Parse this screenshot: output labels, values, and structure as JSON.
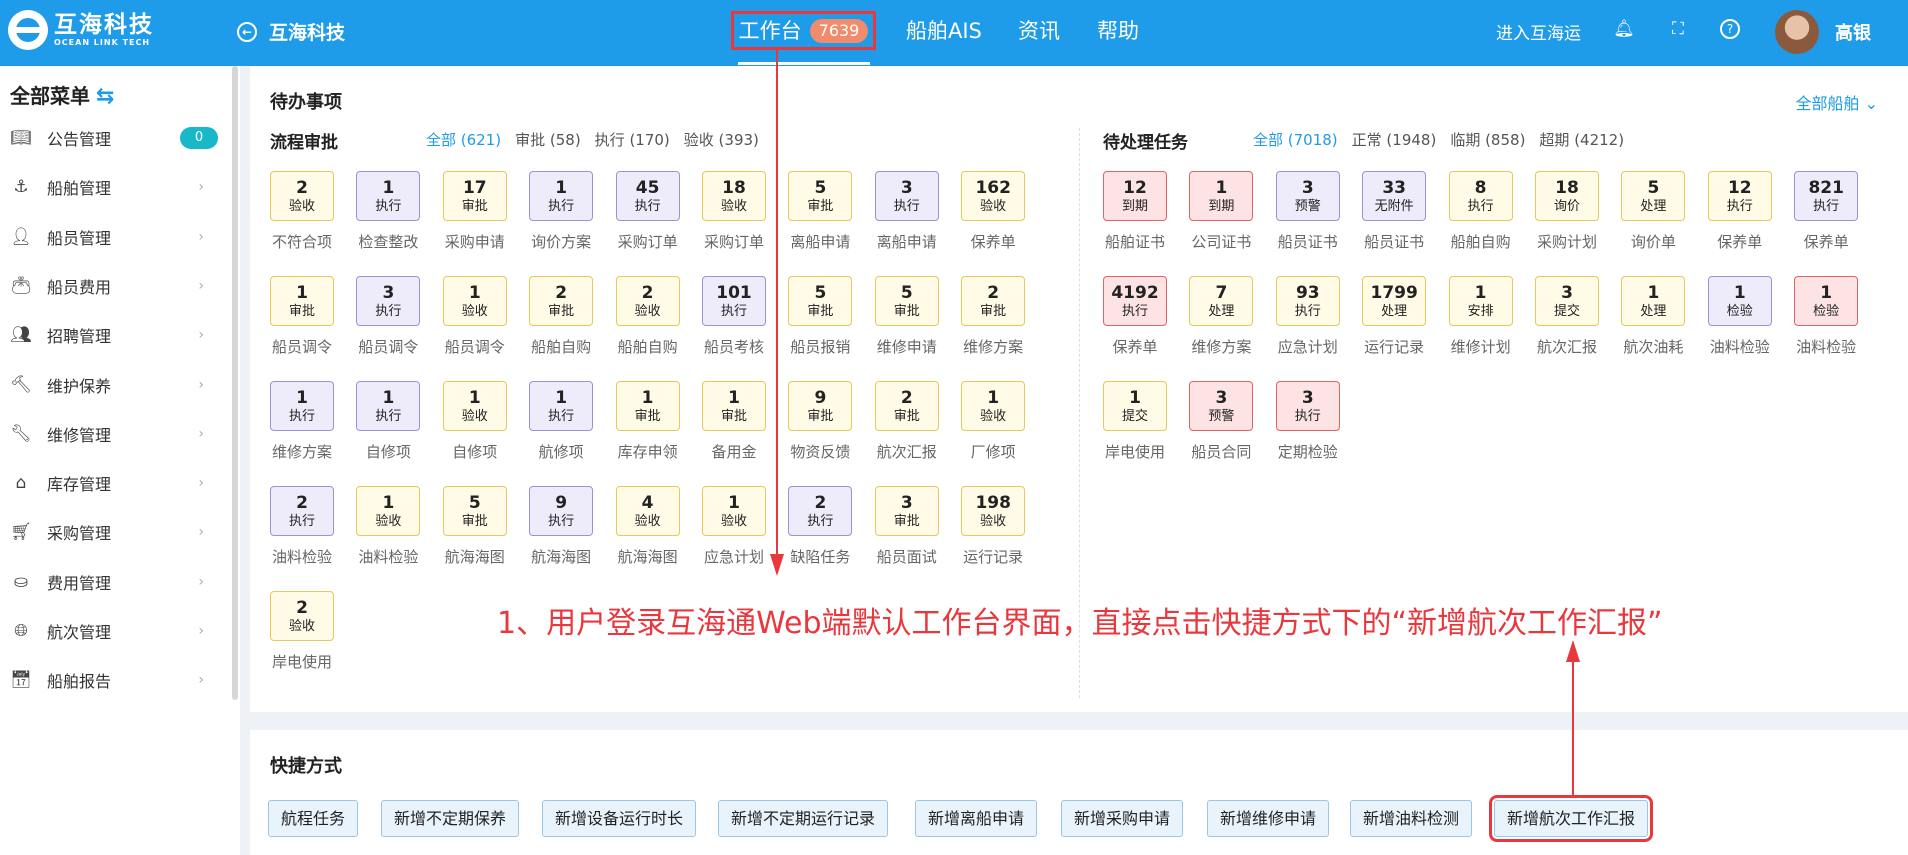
{
  "app": {
    "logo_cn": "互海科技",
    "logo_en": "OCEAN LINK TECH",
    "back_title": "互海科技"
  },
  "nav": {
    "workbench": "工作台",
    "workbench_count": "7639",
    "ais": "船舶AIS",
    "news": "资讯",
    "help": "帮助"
  },
  "header_right": {
    "enter": "进入互海运",
    "user": "高银"
  },
  "sidebar": {
    "title": "全部菜单",
    "items": [
      {
        "label": "公告管理",
        "icon": "document-icon",
        "badge": "0"
      },
      {
        "label": "船舶管理",
        "icon": "anchor-icon"
      },
      {
        "label": "船员管理",
        "icon": "person-icon"
      },
      {
        "label": "船员费用",
        "icon": "wallet-icon"
      },
      {
        "label": "招聘管理",
        "icon": "recruit-icon"
      },
      {
        "label": "维护保养",
        "icon": "hammer-icon"
      },
      {
        "label": "维修管理",
        "icon": "wrench-icon"
      },
      {
        "label": "库存管理",
        "icon": "warehouse-icon"
      },
      {
        "label": "采购管理",
        "icon": "cart-icon"
      },
      {
        "label": "费用管理",
        "icon": "coins-icon"
      },
      {
        "label": "航次管理",
        "icon": "globe-icon"
      },
      {
        "label": "船舶报告",
        "icon": "calendar-icon"
      }
    ]
  },
  "todo": {
    "title": "待办事项",
    "all_ships": "全部船舶",
    "approval": {
      "title": "流程审批",
      "filters": [
        "全部 (621)",
        "审批 (58)",
        "执行 (170)",
        "验收 (393)"
      ],
      "tiles": [
        {
          "n": "2",
          "t": "验收",
          "c": "不符合项",
          "k": "y"
        },
        {
          "n": "1",
          "t": "执行",
          "c": "检查整改",
          "k": "p"
        },
        {
          "n": "17",
          "t": "审批",
          "c": "采购申请",
          "k": "y"
        },
        {
          "n": "1",
          "t": "执行",
          "c": "询价方案",
          "k": "p"
        },
        {
          "n": "45",
          "t": "执行",
          "c": "采购订单",
          "k": "p"
        },
        {
          "n": "18",
          "t": "验收",
          "c": "采购订单",
          "k": "y"
        },
        {
          "n": "5",
          "t": "审批",
          "c": "离船申请",
          "k": "y"
        },
        {
          "n": "3",
          "t": "执行",
          "c": "离船申请",
          "k": "p"
        },
        {
          "n": "162",
          "t": "验收",
          "c": "保养单",
          "k": "y"
        },
        {
          "n": "1",
          "t": "审批",
          "c": "船员调令",
          "k": "y"
        },
        {
          "n": "3",
          "t": "执行",
          "c": "船员调令",
          "k": "p"
        },
        {
          "n": "1",
          "t": "验收",
          "c": "船员调令",
          "k": "y"
        },
        {
          "n": "2",
          "t": "审批",
          "c": "船舶自购",
          "k": "y"
        },
        {
          "n": "2",
          "t": "验收",
          "c": "船舶自购",
          "k": "y"
        },
        {
          "n": "101",
          "t": "执行",
          "c": "船员考核",
          "k": "p"
        },
        {
          "n": "5",
          "t": "审批",
          "c": "船员报销",
          "k": "y"
        },
        {
          "n": "5",
          "t": "审批",
          "c": "维修申请",
          "k": "y"
        },
        {
          "n": "2",
          "t": "审批",
          "c": "维修方案",
          "k": "y"
        },
        {
          "n": "1",
          "t": "执行",
          "c": "维修方案",
          "k": "p"
        },
        {
          "n": "1",
          "t": "执行",
          "c": "自修项",
          "k": "p"
        },
        {
          "n": "1",
          "t": "验收",
          "c": "自修项",
          "k": "y"
        },
        {
          "n": "1",
          "t": "执行",
          "c": "航修项",
          "k": "p"
        },
        {
          "n": "1",
          "t": "审批",
          "c": "库存申领",
          "k": "y"
        },
        {
          "n": "1",
          "t": "审批",
          "c": "备用金",
          "k": "y"
        },
        {
          "n": "9",
          "t": "审批",
          "c": "物资反馈",
          "k": "y"
        },
        {
          "n": "2",
          "t": "审批",
          "c": "航次汇报",
          "k": "y"
        },
        {
          "n": "1",
          "t": "验收",
          "c": "厂修项",
          "k": "y"
        },
        {
          "n": "2",
          "t": "执行",
          "c": "油料检验",
          "k": "p"
        },
        {
          "n": "1",
          "t": "验收",
          "c": "油料检验",
          "k": "y"
        },
        {
          "n": "5",
          "t": "审批",
          "c": "航海海图",
          "k": "y"
        },
        {
          "n": "9",
          "t": "执行",
          "c": "航海海图",
          "k": "p"
        },
        {
          "n": "4",
          "t": "验收",
          "c": "航海海图",
          "k": "y"
        },
        {
          "n": "1",
          "t": "验收",
          "c": "应急计划",
          "k": "y"
        },
        {
          "n": "2",
          "t": "执行",
          "c": "缺陷任务",
          "k": "p"
        },
        {
          "n": "3",
          "t": "审批",
          "c": "船员面试",
          "k": "y"
        },
        {
          "n": "198",
          "t": "验收",
          "c": "运行记录",
          "k": "y"
        },
        {
          "n": "2",
          "t": "验收",
          "c": "岸电使用",
          "k": "y"
        }
      ]
    },
    "tasks": {
      "title": "待处理任务",
      "filters": [
        "全部 (7018)",
        "正常 (1948)",
        "临期 (858)",
        "超期 (4212)"
      ],
      "tiles": [
        {
          "n": "12",
          "t": "到期",
          "c": "船舶证书",
          "k": "r"
        },
        {
          "n": "1",
          "t": "到期",
          "c": "公司证书",
          "k": "r"
        },
        {
          "n": "3",
          "t": "预警",
          "c": "船员证书",
          "k": "p"
        },
        {
          "n": "33",
          "t": "无附件",
          "c": "船员证书",
          "k": "p"
        },
        {
          "n": "8",
          "t": "执行",
          "c": "船舶自购",
          "k": "y"
        },
        {
          "n": "18",
          "t": "询价",
          "c": "采购计划",
          "k": "y"
        },
        {
          "n": "5",
          "t": "处理",
          "c": "询价单",
          "k": "y"
        },
        {
          "n": "12",
          "t": "执行",
          "c": "保养单",
          "k": "y"
        },
        {
          "n": "821",
          "t": "执行",
          "c": "保养单",
          "k": "p"
        },
        {
          "n": "4192",
          "t": "执行",
          "c": "保养单",
          "k": "r"
        },
        {
          "n": "7",
          "t": "处理",
          "c": "维修方案",
          "k": "y"
        },
        {
          "n": "93",
          "t": "执行",
          "c": "应急计划",
          "k": "y"
        },
        {
          "n": "1799",
          "t": "处理",
          "c": "运行记录",
          "k": "y"
        },
        {
          "n": "1",
          "t": "安排",
          "c": "维修计划",
          "k": "y"
        },
        {
          "n": "3",
          "t": "提交",
          "c": "航次汇报",
          "k": "y"
        },
        {
          "n": "1",
          "t": "处理",
          "c": "航次油耗",
          "k": "y"
        },
        {
          "n": "1",
          "t": "检验",
          "c": "油料检验",
          "k": "p"
        },
        {
          "n": "1",
          "t": "检验",
          "c": "油料检验",
          "k": "r"
        },
        {
          "n": "1",
          "t": "提交",
          "c": "岸电使用",
          "k": "y"
        },
        {
          "n": "3",
          "t": "预警",
          "c": "船员合同",
          "k": "r"
        },
        {
          "n": "3",
          "t": "执行",
          "c": "定期检验",
          "k": "r"
        }
      ]
    }
  },
  "shortcuts": {
    "title": "快捷方式",
    "items": [
      "航程任务",
      "新增不定期保养",
      "新增设备运行时长",
      "新增不定期运行记录",
      "新增离船申请",
      "新增采购申请",
      "新增维修申请",
      "新增油料检测",
      "新增航次工作汇报"
    ]
  },
  "annotation": "1、用户登录互海通Web端默认工作台界面，直接点击快捷方式下的“新增航次工作汇报”",
  "colors": {
    "brand": "#1e9be9",
    "annotation_red": "#e8383d",
    "tile_yellow": "#fffbe6",
    "tile_purple": "#eeebfa",
    "tile_red": "#fde3e3"
  }
}
